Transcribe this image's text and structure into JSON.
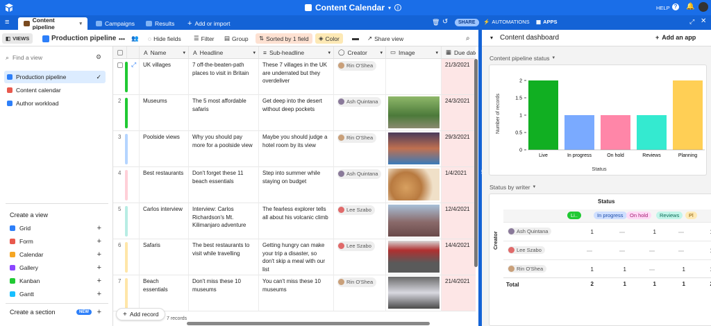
{
  "topbar": {
    "title": "Content Calendar",
    "help": "HELP"
  },
  "tabs": [
    {
      "label": "Content pipeline",
      "color": "#7a4a1e"
    },
    {
      "label": "Campaigns",
      "color": "#7fb3f5"
    },
    {
      "label": "Results",
      "color": "#7fb3f5"
    }
  ],
  "tabbar": {
    "add": "Add or import",
    "share": "SHARE",
    "automations": "AUTOMATIONS",
    "apps": "APPS"
  },
  "viewbar": {
    "views": "VIEWS",
    "view_name": "Production pipeline",
    "hide_fields": "Hide fields",
    "filter": "Filter",
    "group": "Group",
    "sorted": "Sorted by 1 field",
    "color": "Color",
    "share_view": "Share view"
  },
  "sidebar": {
    "find_placeholder": "Find a view",
    "views": [
      {
        "label": "Production pipeline",
        "color": "#2d7ff9"
      },
      {
        "label": "Content calendar",
        "color": "#e8594d"
      },
      {
        "label": "Author workload",
        "color": "#2d7ff9"
      }
    ],
    "create_view": "Create a view",
    "create_items": [
      {
        "label": "Grid",
        "color": "#2d7ff9"
      },
      {
        "label": "Form",
        "color": "#e8594d"
      },
      {
        "label": "Calendar",
        "color": "#f5a623"
      },
      {
        "label": "Gallery",
        "color": "#8b46ff"
      },
      {
        "label": "Kanban",
        "color": "#20c933"
      },
      {
        "label": "Gantt",
        "color": "#18bfff"
      }
    ],
    "create_section": "Create a section",
    "new_badge": "NEW"
  },
  "grid": {
    "columns": [
      "Name",
      "Headline",
      "Sub-headline",
      "Creator",
      "Image",
      "Due date"
    ],
    "rows": [
      {
        "num": "1",
        "color": "#20c933",
        "name": "UK villages",
        "headline": "7 off-the-beaten-path places to visit in Britain",
        "sub": "These 7 villages in the UK are underrated but they overdeliver",
        "creator": "Rin O'Shea",
        "av": "#c9a07a",
        "date": "21/3/2021",
        "img": ""
      },
      {
        "num": "2",
        "color": "#20c933",
        "name": "Museums",
        "headline": "The 5 most affordable safaris",
        "sub": "Get deep into the desert without deep pockets",
        "creator": "Ash Quintana",
        "av": "#8a7a9a",
        "date": "24/3/2021",
        "img": "linear-gradient(180deg,#8fb86a,#4c7a3a 60%,#8a8a70)"
      },
      {
        "num": "3",
        "color": "#b5d5ff",
        "name": "Poolside views",
        "headline": "Why you should pay more for a poolside view",
        "sub": "Maybe you should judge a hotel room by its view",
        "creator": "Rin O'Shea",
        "av": "#c9a07a",
        "date": "29/3/2021",
        "img": "linear-gradient(180deg,#4a3a5a,#c07050 50%,#3a7ab8)"
      },
      {
        "num": "4",
        "color": "#ffd0d8",
        "name": "Best restaurants",
        "headline": "Don't forget these 11 beach essentials",
        "sub": "Step into summer while staying on budget",
        "creator": "Ash Quintana",
        "av": "#8a7a9a",
        "date": "1/4/2021",
        "img": "radial-gradient(circle at 35% 60%,#d8a060,#b87a40 40%,#f0e0c8 70%)"
      },
      {
        "num": "5",
        "color": "#b8ede4",
        "name": "Carlos interview",
        "headline": "Interview: Carlos Richardson's Mt. Kilimanjaro adventure",
        "sub": "The fearless explorer tells all about his volcanic climb",
        "creator": "Lee Szabo",
        "av": "#e06a6a",
        "date": "12/4/2021",
        "img": "linear-gradient(180deg,#a8c0d8,#8a6a6a 55%,#6a4a4a)"
      },
      {
        "num": "6",
        "color": "#ffe6a8",
        "name": "Safaris",
        "headline": "The best restaurants to visit while travelling",
        "sub": "Getting hungry can make your trip a disaster, so don't skip a meal with our list",
        "creator": "Lee Szabo",
        "av": "#e06a6a",
        "date": "14/4/2021",
        "img": "linear-gradient(180deg,#d8d8d8,#b03030 30%,#5a5a5a 70%)"
      },
      {
        "num": "7",
        "color": "#ffe6a8",
        "name": "Beach essentials",
        "headline": "Don't miss these 10 museums",
        "sub": "You can't miss these 10 museums",
        "creator": "Rin O'Shea",
        "av": "#c9a07a",
        "date": "21/4/2021",
        "img": "linear-gradient(180deg,#6a6a6a,#d8d8e0 50%,#4a4a4a)"
      }
    ],
    "add_record": "Add record",
    "record_count": "7 records"
  },
  "dashboard": {
    "title": "Content dashboard",
    "add_app": "Add an app",
    "chart_title": "Content pipeline status",
    "pivot_title": "Status by writer"
  },
  "chart_data": {
    "type": "bar",
    "categories": [
      "Live",
      "In progress",
      "On hold",
      "Reviews",
      "Planning"
    ],
    "values": [
      2,
      1,
      1,
      1,
      2
    ],
    "colors": [
      "#11af22",
      "#7aaaff",
      "#ff86a8",
      "#34ead0",
      "#ffcf55"
    ],
    "xlabel": "Status",
    "ylabel": "Number of records",
    "ylim": [
      0,
      2
    ],
    "yticks": [
      "0",
      "0.5",
      "1",
      "1.5",
      "2"
    ],
    "grid": false,
    "legend": "none"
  },
  "pivot": {
    "col_header": "Status",
    "row_header": "Creator",
    "statuses": [
      {
        "label": "Li..",
        "bg": "#20c933",
        "fg": "#fff"
      },
      {
        "label": "In progress",
        "bg": "#cfdfff",
        "fg": "#1a4ba8"
      },
      {
        "label": "On hold",
        "bg": "#ffdaf6",
        "fg": "#a01a6e"
      },
      {
        "label": "Reviews",
        "bg": "#c2f5e9",
        "fg": "#0a6a56"
      },
      {
        "label": "Pl",
        "bg": "#ffeab6",
        "fg": "#8a5a00"
      }
    ],
    "rows": [
      {
        "name": "Ash Quintana",
        "av": "#8a7a9a",
        "vals": [
          "1",
          "",
          "1",
          "",
          "1"
        ]
      },
      {
        "name": "Lee Szabo",
        "av": "#e06a6a",
        "vals": [
          "",
          "",
          "",
          "",
          "1"
        ]
      },
      {
        "name": "Rin O'Shea",
        "av": "#c9a07a",
        "vals": [
          "1",
          "1",
          "",
          "1",
          "1"
        ]
      }
    ],
    "total_label": "Total",
    "totals": [
      "2",
      "1",
      "1",
      "1",
      "2"
    ]
  }
}
